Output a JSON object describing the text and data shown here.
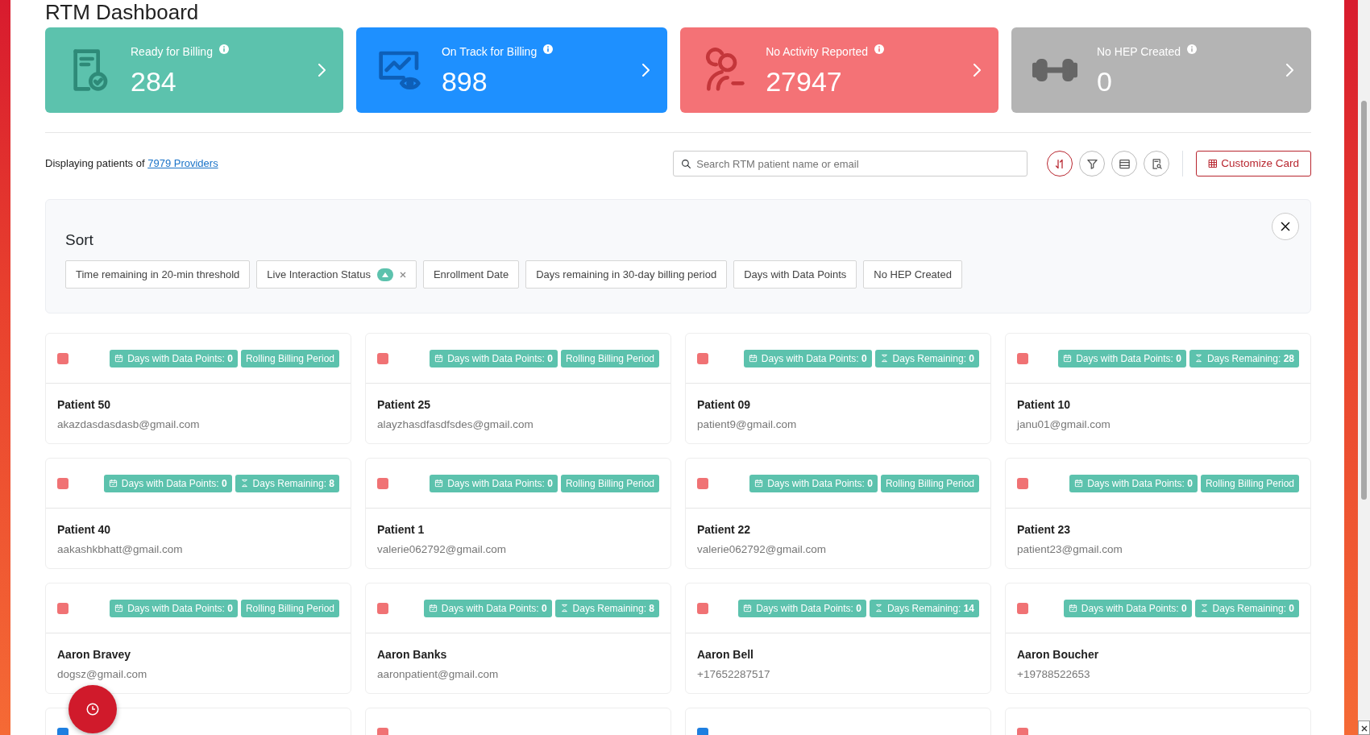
{
  "page_title": "RTM Dashboard",
  "stats": [
    {
      "kind": "document-check",
      "title": "Ready for Billing",
      "value": "284",
      "color": "#5cc2ad"
    },
    {
      "kind": "chart-eye",
      "title": "On Track for Billing",
      "value": "898",
      "color": "#1e90ff"
    },
    {
      "kind": "person-minus",
      "title": "No Activity Reported",
      "value": "27947",
      "color": "#f47276"
    },
    {
      "kind": "dumbbell",
      "title": "No HEP Created",
      "value": "0",
      "color": "#b4b4b4"
    }
  ],
  "providers": {
    "text": "Displaying patients of",
    "link": "7979 Providers"
  },
  "search": {
    "placeholder": "Search RTM patient name or email"
  },
  "tools": [
    {
      "kind": "sort",
      "selected": true
    },
    {
      "kind": "filter",
      "selected": false
    },
    {
      "kind": "list",
      "selected": false
    },
    {
      "kind": "report",
      "selected": false
    }
  ],
  "customize_button": "Customize Card",
  "sort_panel": {
    "title": "Sort",
    "chips": [
      {
        "label": "Time remaining in 20-min threshold",
        "selected": false
      },
      {
        "label": "Live Interaction Status",
        "selected": true
      },
      {
        "label": "Enrollment Date",
        "selected": false
      },
      {
        "label": "Days remaining in 30-day billing period",
        "selected": false
      },
      {
        "label": "Days with Data Points",
        "selected": false
      },
      {
        "label": "No HEP Created",
        "selected": false
      }
    ]
  },
  "patients": [
    {
      "name": "Patient 50",
      "contact": "akazdasdasdasb@gmail.com",
      "color": "#f07274",
      "badges": [
        {
          "kind": "data",
          "text": "Days with Data Points: **0**"
        },
        {
          "kind": "rolling",
          "text": "Rolling Billing Period"
        }
      ]
    },
    {
      "name": "Patient 25",
      "contact": "alayzhasdfasdfsdes@gmail.com",
      "color": "#f07274",
      "badges": [
        {
          "kind": "data",
          "text": "Days with Data Points: **0**"
        },
        {
          "kind": "rolling",
          "text": "Rolling Billing Period"
        }
      ]
    },
    {
      "name": "Patient 09",
      "contact": "patient9@gmail.com",
      "color": "#f07274",
      "badges": [
        {
          "kind": "data",
          "text": "Days with Data Points: **0**"
        },
        {
          "kind": "remaining",
          "text": "Days Remaining: **0**"
        }
      ]
    },
    {
      "name": "Patient 10",
      "contact": "janu01@gmail.com",
      "color": "#f07274",
      "badges": [
        {
          "kind": "data",
          "text": "Days with Data Points: **0**"
        },
        {
          "kind": "remaining",
          "text": "Days Remaining: **28**"
        }
      ]
    },
    {
      "name": "Patient 40",
      "contact": "aakashkbhatt@gmail.com",
      "color": "#f07274",
      "badges": [
        {
          "kind": "data",
          "text": "Days with Data Points: **0**"
        },
        {
          "kind": "remaining",
          "text": "Days Remaining: **8**"
        }
      ]
    },
    {
      "name": "Patient 1",
      "contact": "valerie062792@gmail.com",
      "color": "#f07274",
      "badges": [
        {
          "kind": "data",
          "text": "Days with Data Points: **0**"
        },
        {
          "kind": "rolling",
          "text": "Rolling Billing Period"
        }
      ]
    },
    {
      "name": "Patient 22",
      "contact": "valerie062792@gmail.com",
      "color": "#f07274",
      "badges": [
        {
          "kind": "data",
          "text": "Days with Data Points: **0**"
        },
        {
          "kind": "rolling",
          "text": "Rolling Billing Period"
        }
      ]
    },
    {
      "name": "Patient 23",
      "contact": "patient23@gmail.com",
      "color": "#f07274",
      "badges": [
        {
          "kind": "data",
          "text": "Days with Data Points: **0**"
        },
        {
          "kind": "rolling",
          "text": "Rolling Billing Period"
        }
      ]
    },
    {
      "name": "Aaron Bravey",
      "contact": "dogsz@gmail.com",
      "color": "#f07274",
      "badges": [
        {
          "kind": "data",
          "text": "Days with Data Points: **0**"
        },
        {
          "kind": "rolling",
          "text": "Rolling Billing Period"
        }
      ]
    },
    {
      "name": "Aaron Banks",
      "contact": "aaronpatient@gmail.com",
      "color": "#f07274",
      "badges": [
        {
          "kind": "data",
          "text": "Days with Data Points: **0**"
        },
        {
          "kind": "remaining",
          "text": "Days Remaining: **8**"
        }
      ]
    },
    {
      "name": "Aaron Bell",
      "contact": "+17652287517",
      "color": "#f07274",
      "badges": [
        {
          "kind": "data",
          "text": "Days with Data Points: **0**"
        },
        {
          "kind": "remaining",
          "text": "Days Remaining: **14**"
        }
      ]
    },
    {
      "name": "Aaron Boucher",
      "contact": "+19788522653",
      "color": "#f07274",
      "badges": [
        {
          "kind": "data",
          "text": "Days with Data Points: **0**"
        },
        {
          "kind": "remaining",
          "text": "Days Remaining: **0**"
        }
      ]
    },
    {
      "color": "#1e7fe0"
    },
    {
      "color": "#f07274"
    },
    {
      "color": "#1e7fe0"
    },
    {
      "color": "#f07274"
    }
  ]
}
